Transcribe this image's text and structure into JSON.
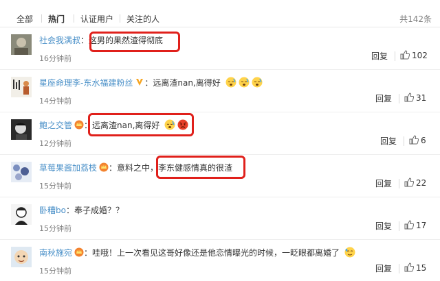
{
  "tabs": [
    {
      "label": "全部",
      "active": false
    },
    {
      "label": "热门",
      "active": true
    },
    {
      "label": "认证用户",
      "active": false
    },
    {
      "label": "关注的人",
      "active": false
    }
  ],
  "total": "共142条",
  "reply_label": "回复",
  "comments": [
    {
      "user": "社会我满叔",
      "badge": "",
      "text": "这男的果然渣得彻底",
      "emojis": [],
      "time": "16分钟前",
      "likes": "102"
    },
    {
      "user": "星座命理李-东水福建粉丝",
      "badge": "vip-v-badge",
      "text": "远离渣nan,离得好",
      "emojis": [
        "sleepy-face",
        "sleepy-face",
        "sleepy-face"
      ],
      "time": "14分钟前",
      "likes": "31"
    },
    {
      "user": "鲍之交管",
      "badge": "crown-badge",
      "text": "远离渣nan,离得好",
      "emojis": [
        "sleepy-face",
        "angry-face"
      ],
      "time": "12分钟前",
      "likes": "6"
    },
    {
      "user": "草莓果酱加荔枝",
      "badge": "crown-badge",
      "text": "意料之中，李东健感情真的很渣",
      "emojis": [],
      "time": "15分钟前",
      "likes": "22"
    },
    {
      "user": "卧糟bo",
      "badge": "",
      "text": "奉子成婚？？",
      "emojis": [],
      "time": "15分钟前",
      "likes": "17"
    },
    {
      "user": "南秋施宛",
      "badge": "crown-badge",
      "text": "哇哦！上一次看见这哥好像还是他恋情曝光的时候，一眨眼都离婚了",
      "emojis": [
        "sweat-face"
      ],
      "time": "15分钟前",
      "likes": "15"
    }
  ],
  "colors": {
    "username": "#eb7350",
    "highlight": "#e0201b",
    "link": "#4a90c8"
  }
}
